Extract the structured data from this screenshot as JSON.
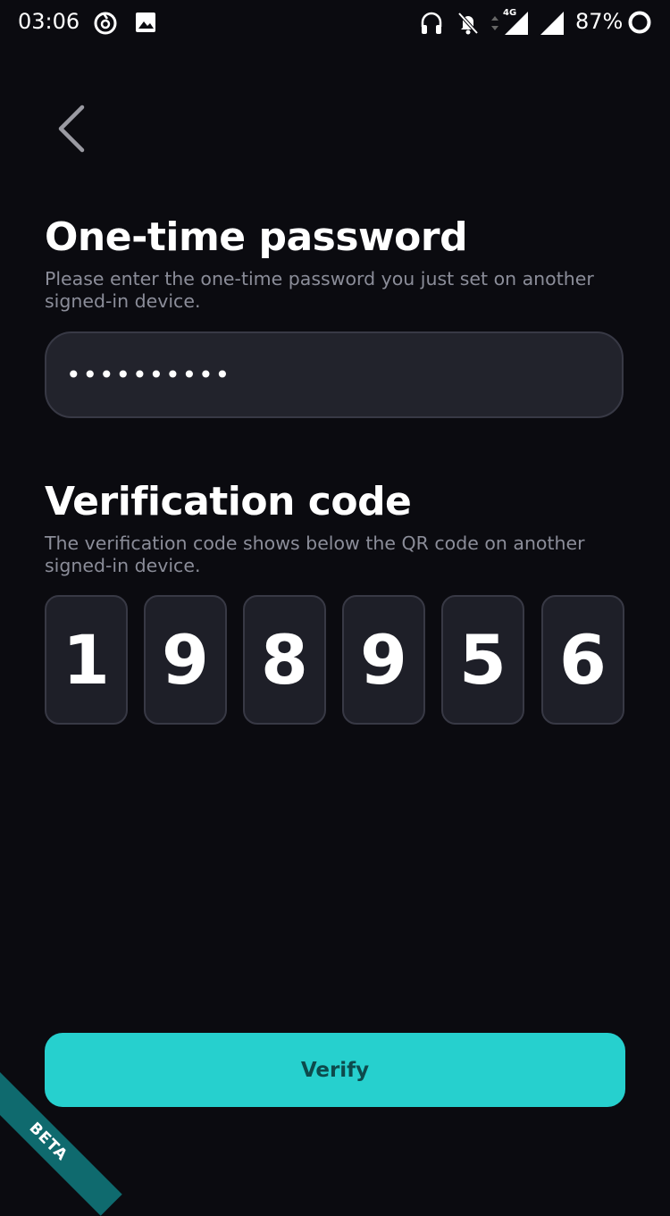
{
  "status_bar": {
    "time": "03:06",
    "network_type": "4G",
    "battery": "87%",
    "left_icons": [
      "netease-music-icon",
      "image-notification-icon"
    ],
    "right_icons": [
      "headphones-icon",
      "notifications-off-icon",
      "data-arrows-icon",
      "signal-icon",
      "signal-icon",
      "battery-ring-icon"
    ]
  },
  "back": {
    "icon": "chevron-left-icon"
  },
  "password_section": {
    "title": "One-time password",
    "description": "Please enter the one-time password you just set on another signed-in device.",
    "value": "••••••••••"
  },
  "verification_section": {
    "title": "Verification code",
    "description": "The verification code shows below the QR code on another signed-in device.",
    "digits": [
      "1",
      "9",
      "8",
      "9",
      "5",
      "6"
    ]
  },
  "verify_button": {
    "label": "Verify"
  },
  "ribbon": {
    "label": "BETA"
  },
  "colors": {
    "background": "#0b0b10",
    "field_background": "#22232c",
    "field_border": "#383945",
    "description_text": "#8b8d99",
    "accent": "#26d0ce",
    "accent_text": "#0d4a4c",
    "ribbon": "#0f6a6e"
  }
}
